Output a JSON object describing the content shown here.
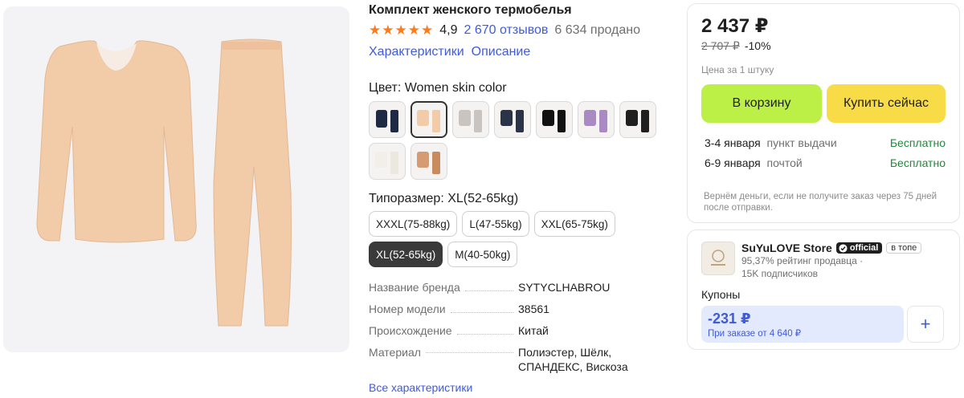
{
  "product": {
    "title": "Комплект женского термобелья",
    "rating": "4,9",
    "reviews": "2 670 отзывов",
    "sold": "6 634 продано",
    "tabs": [
      "Характеристики",
      "Описание"
    ]
  },
  "color": {
    "label": "Цвет: Women skin color",
    "selected_index": 1,
    "swatch_count": 9
  },
  "size": {
    "label": "Типоразмер: XL(52-65kg)",
    "options": [
      "XXXL(75-88kg)",
      "L(47-55kg)",
      "XXL(65-75kg)",
      "XL(52-65kg)",
      "M(40-50kg)"
    ],
    "selected": "XL(52-65kg)"
  },
  "specs": [
    {
      "key": "Название бренда",
      "value": "SYTYCLHABROU"
    },
    {
      "key": "Номер модели",
      "value": "38561"
    },
    {
      "key": "Происхождение",
      "value": "Китай"
    },
    {
      "key": "Материал",
      "value": "Полиэстер, Шёлк, СПАНДЕКС, Вискоза"
    }
  ],
  "all_specs_link": "Все характеристики",
  "buy": {
    "price": "2 437 ₽",
    "old_price": "2 707 ₽",
    "discount": "-10%",
    "unit_note": "Цена за 1 штуку",
    "cart_label": "В корзину",
    "buy_now_label": "Купить сейчас",
    "delivery": [
      {
        "date": "3-4 января",
        "method": "пункт выдачи",
        "price": "Бесплатно"
      },
      {
        "date": "6-9 января",
        "method": "почтой",
        "price": "Бесплатно"
      }
    ],
    "refund_note": "Вернём деньги, если не получите заказ через 75 дней после отправки."
  },
  "store": {
    "name": "SuYuLOVE Store",
    "official_badge": "official",
    "top_badge": "в топе",
    "rating_line": "95,37% рейтинг продавца",
    "subscribers": "15K подписчиков",
    "coupons_label": "Купоны",
    "coupon_amount": "-231 ₽",
    "coupon_condition": "При заказе от 4 640 ₽"
  },
  "colors": {
    "accent": "#3f5bd9",
    "cart_button": "#bdf046",
    "buy_button": "#f8dc47",
    "star": "#ff7a1a",
    "free": "#1f8a3a",
    "garment": "#f1cba8"
  }
}
